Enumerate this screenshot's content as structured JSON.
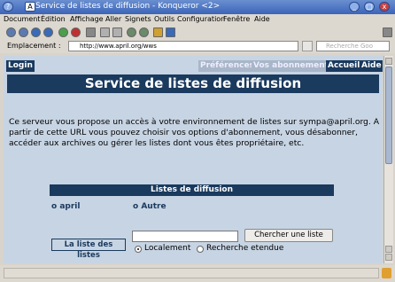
{
  "window": {
    "title": "Service de listes de diffusion - Konqueror <2>",
    "app_icon": "A",
    "button_icons": [
      "?",
      "_",
      "□",
      "x"
    ]
  },
  "menubar": {
    "items": [
      "Document",
      "Édition",
      "Affichage",
      "Aller",
      "Signets",
      "Outils",
      "Configuration",
      "Fenêtre",
      "Aide"
    ]
  },
  "location": {
    "label": "Emplacement :",
    "url": "http://www.april.org/wws",
    "search_placeholder": "Recherche Goo"
  },
  "page": {
    "nav": {
      "login": "Login",
      "preferences": "Préférences",
      "subscriptions": "Vos abonnements",
      "home": "Accueil",
      "help": "Aide"
    },
    "banner_title": "Service de listes de diffusion",
    "intro": "Ce serveur vous propose un accès à votre environnement de listes sur sympa@april.org. A partir de cette URL vous pouvez choisir vos options d'abonnement, vous désabonner, accéder aux archives ou gérer les listes dont vous êtes propriétaire, etc.",
    "lists_header": "Listes de diffusion",
    "lists": [
      {
        "label": "april"
      },
      {
        "label": "Autre"
      }
    ],
    "search": {
      "label": "La liste des listes",
      "button": "Chercher une liste",
      "options": [
        "Localement",
        "Recherche etendue"
      ],
      "selected": 0
    }
  },
  "colors": {
    "accent": "#1a3a5e",
    "page_bg": "#c7d4e3"
  }
}
